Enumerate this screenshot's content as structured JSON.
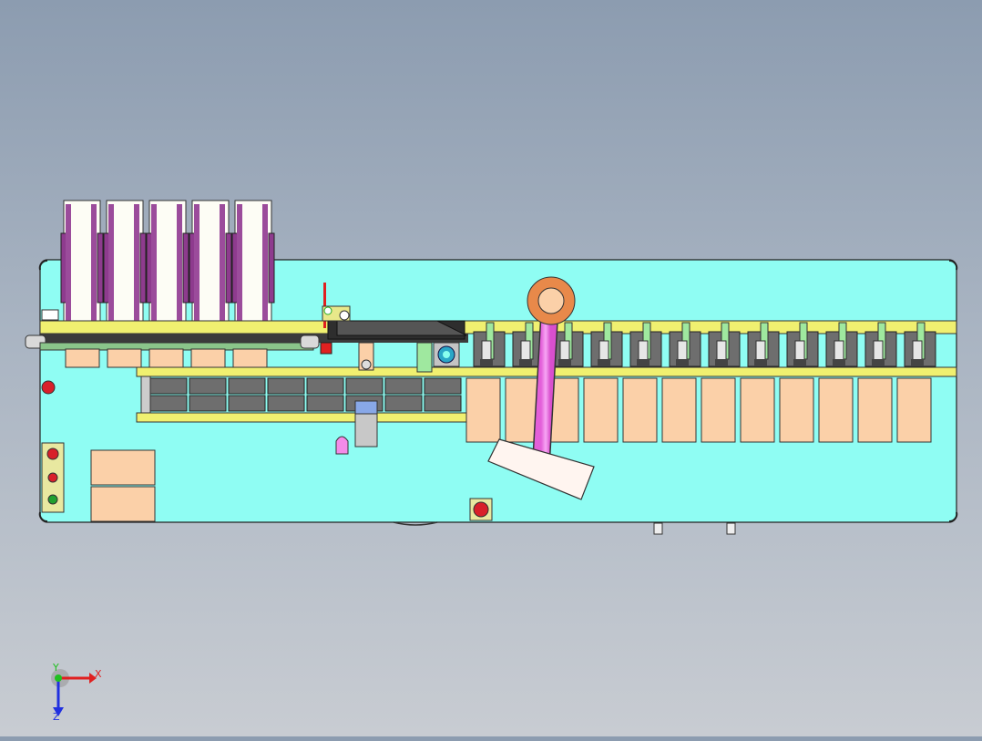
{
  "viewport": {
    "background_top": "#8c9cb0",
    "background_bottom": "#c8ccd2"
  },
  "model": {
    "base_plate_color": "#8ffdf3",
    "rail_color": "#f0f070",
    "tray_color": "#fbd0a8",
    "magazine_frame_color": "#8e3b8e",
    "hose_color": "#ef7ded",
    "flange_color": "#e8894a",
    "dark_block_color": "#6e6e6e",
    "green_part_color": "#9fe89f",
    "button_red": "#d8202a",
    "button_green": "#20a030",
    "magazine_count": 5,
    "station_count": 12,
    "tray_count": 12,
    "control_panel_lamps": [
      "red",
      "red",
      "green"
    ],
    "emergency_stop_color": "#d8202a"
  },
  "triad": {
    "x_label": "X",
    "y_label": "Y",
    "z_label": "Z",
    "x_color": "#e02020",
    "y_color": "#20c020",
    "z_color": "#2030e0"
  }
}
